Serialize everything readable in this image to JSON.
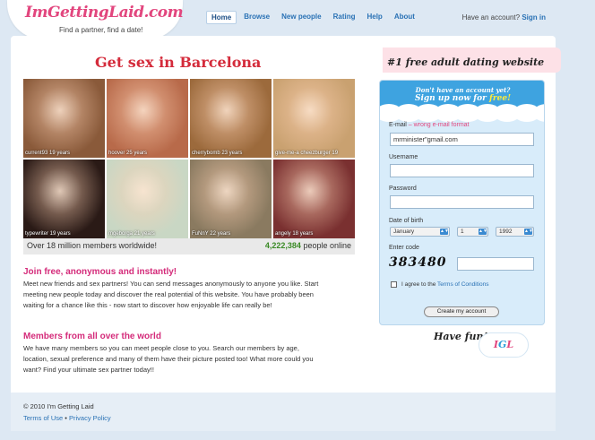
{
  "brand": {
    "logo": "ImGettingLaid.com",
    "tagline": "Find a partner, find a date!"
  },
  "nav": {
    "items": [
      {
        "label": "Home"
      },
      {
        "label": "Browse"
      },
      {
        "label": "New people"
      },
      {
        "label": "Rating"
      },
      {
        "label": "Help"
      },
      {
        "label": "About"
      }
    ]
  },
  "account": {
    "text": "Have an account?",
    "sign_in": "Sign in"
  },
  "main": {
    "title": "Get sex in Barcelona",
    "photos": [
      {
        "caption": "current93 19 years",
        "bg": "#8a5a3a"
      },
      {
        "caption": "hoover 25 years",
        "bg": "#b86a4a"
      },
      {
        "caption": "cherrybomb 23 years",
        "bg": "#9c6a3c"
      },
      {
        "caption": "give-me-a cheezburger 19",
        "bg": "#c9a170"
      },
      {
        "caption": "typewriter 19 years",
        "bg": "#2a1a16"
      },
      {
        "caption": "mgeborga 21 years",
        "bg": "#c9d7c4"
      },
      {
        "caption": "FuNnY 22 years",
        "bg": "#8a7a60"
      },
      {
        "caption": "angely 18 years",
        "bg": "#7a3030"
      }
    ],
    "stats": {
      "left": "Over 18 million members worldwide!",
      "online_count": "4,222,384",
      "online_label": "people online"
    },
    "section1": {
      "title": "Join free, anonymous and instantly!",
      "body": "Meet new friends and sex partners! You can send messages anonymously to anyone you like. Start meeting new people today and discover the real potential of this website. You have probably been waiting for a chance like this - now start to discover how enjoyable life can really be!"
    },
    "section2": {
      "title": "Members from all over the world",
      "body": "We have many members so you can meet people close to you. Search our members by age, location, sexual preference and many of them have their picture posted too! What more could you want? Find your ultimate sex partner today!!"
    }
  },
  "signup": {
    "right_title": "#1 free adult dating website",
    "head_line1": "Don't have an account yet?",
    "head_line2": "Sign up now for",
    "head_free": "free!",
    "email_label": "E-mail",
    "email_error": "– wrong e-mail format",
    "email_value": "mrminister\"gmail.com",
    "username_label": "Username",
    "password_label": "Password",
    "dob_label": "Date of birth",
    "dob_month": "January",
    "dob_day": "1",
    "dob_year": "1992",
    "code_label": "Enter code",
    "captcha": "383480",
    "agree_text": "I agree to the",
    "agree_link": "Terms of Conditions",
    "create_button": "Create my account"
  },
  "havefun": "Have fun!",
  "igl": {
    "i": "I",
    "g": "G",
    "l": "L"
  },
  "footer": {
    "copyright": "© 2010 I'm Getting Laid",
    "terms": "Terms of Use",
    "sep": " • ",
    "privacy": "Privacy Policy"
  },
  "colors": {
    "pink": "#e2467e",
    "blue": "#2b9ed8",
    "red_title": "#d42b3b",
    "green_count": "#3a8a26"
  }
}
